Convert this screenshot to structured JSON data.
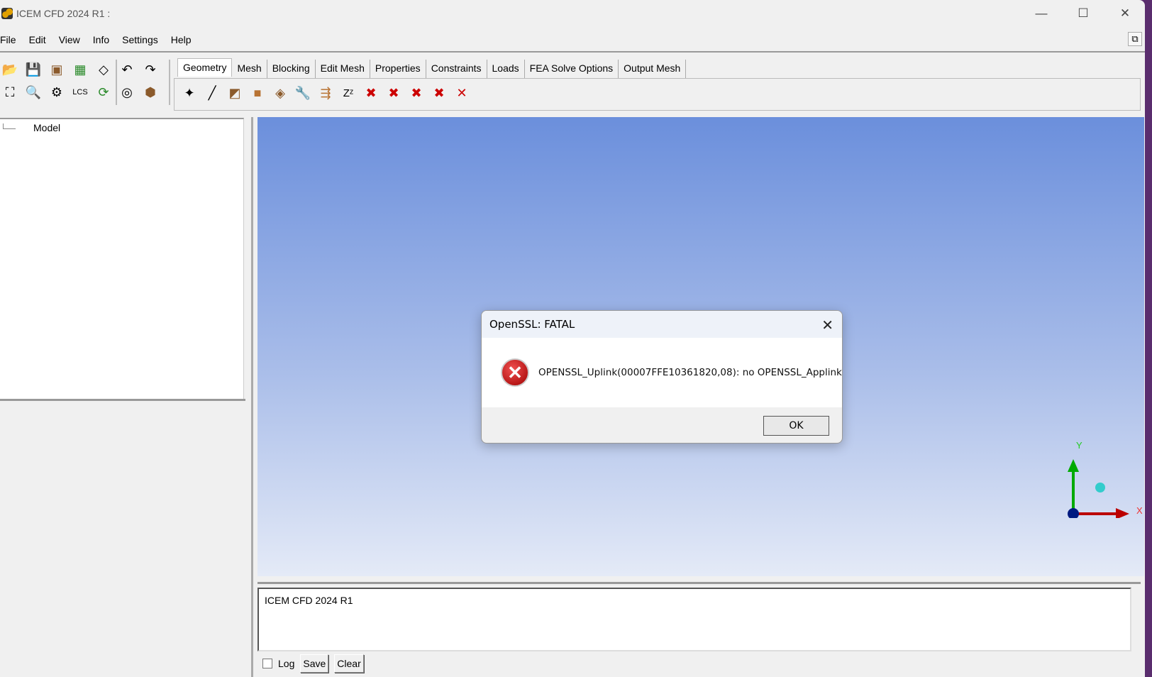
{
  "window": {
    "title": "ICEM CFD 2024 R1 :",
    "minimize": "—",
    "maximize": "☐",
    "close": "✕",
    "restore": "⧉"
  },
  "menu": [
    "File",
    "Edit",
    "View",
    "Info",
    "Settings",
    "Help"
  ],
  "tabs": [
    "Geometry",
    "Mesh",
    "Blocking",
    "Edit Mesh",
    "Properties",
    "Constraints",
    "Loads",
    "FEA Solve Options",
    "Output Mesh"
  ],
  "active_tab": "Geometry",
  "tree": {
    "root": "Model"
  },
  "messages": {
    "text": "ICEM CFD 2024 R1",
    "log_label": "Log",
    "save_label": "Save",
    "clear_label": "Clear"
  },
  "axes": {
    "x_label": "X",
    "y_label": "Y"
  },
  "dialog": {
    "title": "OpenSSL: FATAL",
    "message": "OPENSSL_Uplink(00007FFE10361820,08): no OPENSSL_Applink",
    "ok_label": "OK",
    "close": "✕",
    "icon": "error-icon"
  }
}
